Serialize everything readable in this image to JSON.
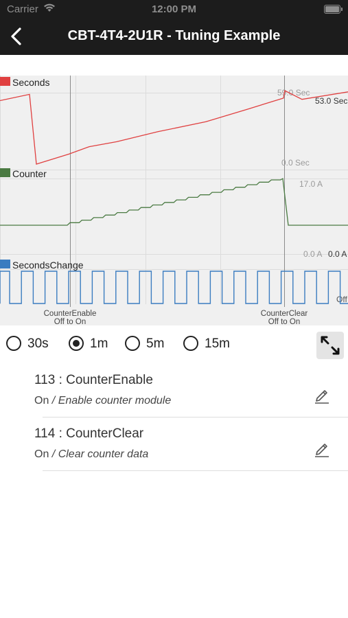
{
  "status_bar": {
    "carrier": "Carrier",
    "time": "12:00 PM"
  },
  "nav": {
    "title": "CBT-4T4-2U1R - Tuning Example",
    "back_icon": "chevron-left-icon"
  },
  "chart_data": {
    "type": "line",
    "x_range_label": "1m",
    "markers": [
      {
        "label_line1": "CounterEnable",
        "label_line2": "Off to On"
      },
      {
        "label_line1": "CounterClear",
        "label_line2": "Off to On"
      }
    ],
    "series": [
      {
        "name": "Seconds",
        "color": "#e04040",
        "axis_top_label": "59.0 Sec",
        "axis_bottom_label": "0.0 Sec",
        "current_value_label": "53.0 Sec",
        "x": [
          0,
          10,
          12,
          20,
          55,
          58,
          100,
          103,
          300,
          304,
          406,
          410,
          440,
          460
        ],
        "y": [
          51,
          56,
          0,
          1,
          8,
          9,
          25,
          26,
          42,
          43,
          59,
          59,
          58,
          59
        ]
      },
      {
        "name": "Counter",
        "color": "#4a7a42",
        "axis_top_label": "17.0 A",
        "axis_bottom_label": "0.0 A",
        "current_value_label": "0.0 A",
        "x": [
          0,
          25,
          30,
          33,
          40,
          80,
          100,
          101,
          102,
          103,
          104,
          106,
          110,
          115,
          120,
          160,
          190,
          225,
          255,
          275,
          295,
          300,
          302,
          304,
          306,
          308,
          310
        ],
        "y": [
          0,
          0,
          1,
          2,
          3,
          4,
          5,
          6,
          7,
          8,
          9,
          10,
          11,
          12,
          13,
          14,
          15,
          15.5,
          16,
          16.5,
          17,
          0,
          0,
          0,
          0,
          0,
          0
        ]
      },
      {
        "name": "SecondsChange",
        "color": "#3a7cc0",
        "current_value_label": "Off",
        "period_px": 34.4,
        "first_edge_px": 14,
        "values": [
          "On",
          "Off"
        ]
      }
    ]
  },
  "time_ranges": {
    "options": [
      "30s",
      "1m",
      "5m",
      "15m"
    ],
    "selected": "1m"
  },
  "expand_icon": "expand-icon",
  "parameters": [
    {
      "id": "113",
      "separator": " : ",
      "name": "CounterEnable",
      "value": "On",
      "desc": "/ Enable counter module",
      "icon": "edit-icon"
    },
    {
      "id": "114",
      "separator": " : ",
      "name": "CounterClear",
      "value": "On",
      "desc": "/ Clear counter data",
      "icon": "edit-icon"
    }
  ]
}
